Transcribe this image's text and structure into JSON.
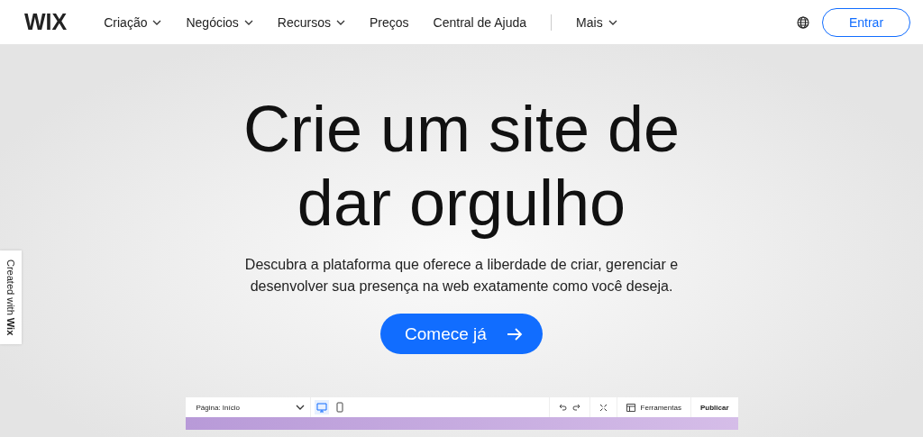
{
  "header": {
    "logo": "WIX",
    "nav": [
      {
        "label": "Criação",
        "kind": "dropdown"
      },
      {
        "label": "Negócios",
        "kind": "dropdown"
      },
      {
        "label": "Recursos",
        "kind": "dropdown"
      },
      {
        "label": "Preços",
        "kind": "link"
      },
      {
        "label": "Central de Ajuda",
        "kind": "link"
      },
      {
        "label": "Mais",
        "kind": "dropdown"
      }
    ],
    "login_button": "Entrar"
  },
  "hero": {
    "title": "Crie um site de dar orgulho",
    "subtitle": "Descubra a plataforma que oferece a liberdade de criar, gerenciar e desenvolver sua presença na web exatamente como você deseja.",
    "cta": "Comece já"
  },
  "side_tab": "Created with **Wix**",
  "editor_preview": {
    "page_select": "Página: Início",
    "devices": [
      {
        "kind": "desktop",
        "selected": true
      },
      {
        "kind": "mobile",
        "selected": false
      }
    ],
    "tools_button": "Ferramentas",
    "publish_button": "Publicar"
  }
}
